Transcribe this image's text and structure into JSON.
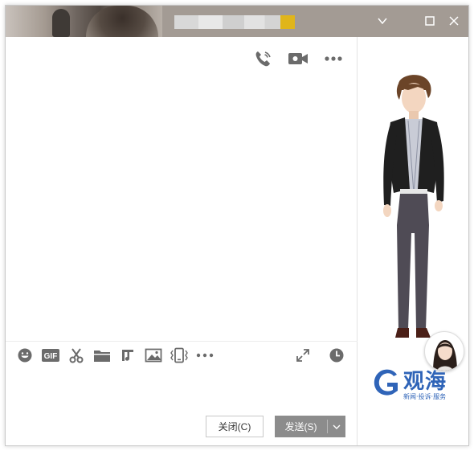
{
  "window": {
    "controls": {
      "dropdown_icon": "chevron-down-icon",
      "maximize_icon": "maximize-icon",
      "close_icon": "close-icon"
    }
  },
  "chat_header": {
    "actions": [
      "voice-call-icon",
      "video-call-icon",
      "more-icon"
    ]
  },
  "toolbar": {
    "tools": [
      "emoji-icon",
      "gif-icon",
      "screenshot-scissors-icon",
      "file-folder-icon",
      "music-icon",
      "image-icon",
      "shake-window-icon",
      "more-icon"
    ],
    "gif_label": "GIF",
    "right_tools": [
      "expand-icon",
      "history-clock-icon"
    ]
  },
  "buttons": {
    "close_label": "关闭(C)",
    "send_label": "发送(S)"
  },
  "side_panel": {
    "logo_text": "观海",
    "logo_subtitle": "新闻·投诉·服务"
  },
  "colors": {
    "title_bar": "#a39b94",
    "icon_gray": "#6b6b6b",
    "send_button": "#8c8c8c",
    "logo_blue": "#2f64b8"
  }
}
